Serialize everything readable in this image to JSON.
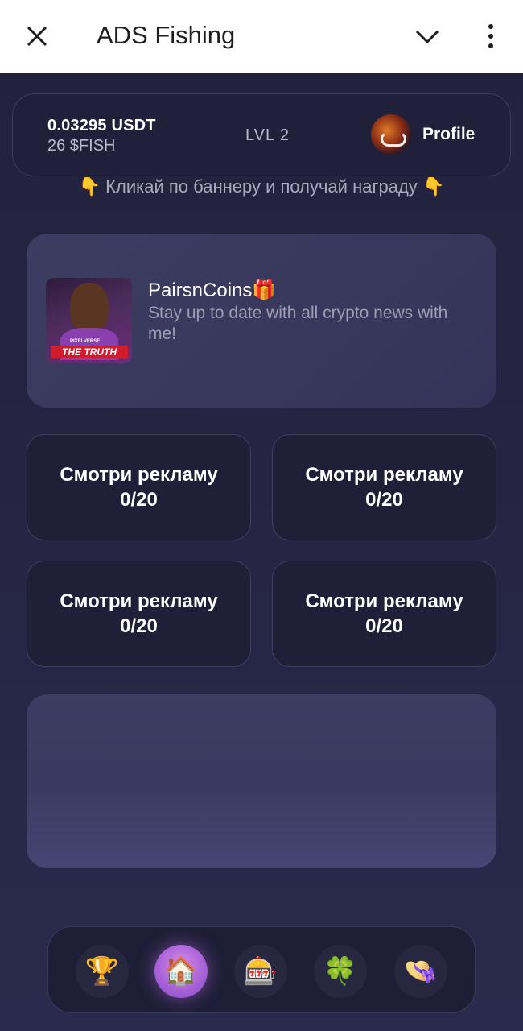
{
  "header": {
    "title": "ADS Fishing"
  },
  "account": {
    "usdt_balance": "0.03295 USDT",
    "fish_balance": "26 $FISH",
    "level": "LVL 2",
    "profile_label": "Profile"
  },
  "hint": {
    "text": "Кликай по баннеру и получай награду",
    "emoji_left": "👇",
    "emoji_right": "👇"
  },
  "ad": {
    "title": "PairsnCoins🎁",
    "description": "Stay up to date with all crypto news with me!",
    "thumb_caption": "THE TRUTH",
    "thumb_subcaption": "PIXELVERSE"
  },
  "watch_buttons": [
    {
      "label": "Смотри рекламу",
      "count": "0/20"
    },
    {
      "label": "Смотри рекламу",
      "count": "0/20"
    },
    {
      "label": "Смотри рекламу",
      "count": "0/20"
    },
    {
      "label": "Смотри рекламу",
      "count": "0/20"
    }
  ],
  "nav": [
    {
      "icon": "trophy-icon",
      "glyph": "🏆",
      "active": false
    },
    {
      "icon": "home-icon",
      "glyph": "🏠",
      "active": true
    },
    {
      "icon": "slot-machine-icon",
      "glyph": "🎰",
      "active": false
    },
    {
      "icon": "clover-icon",
      "glyph": "🍀",
      "active": false
    },
    {
      "icon": "hat-icon",
      "glyph": "👒",
      "active": false
    }
  ],
  "colors": {
    "background": "#24243f",
    "card": "#20203a",
    "banner": "#3b3b60",
    "active_nav": "#b06ad9"
  }
}
